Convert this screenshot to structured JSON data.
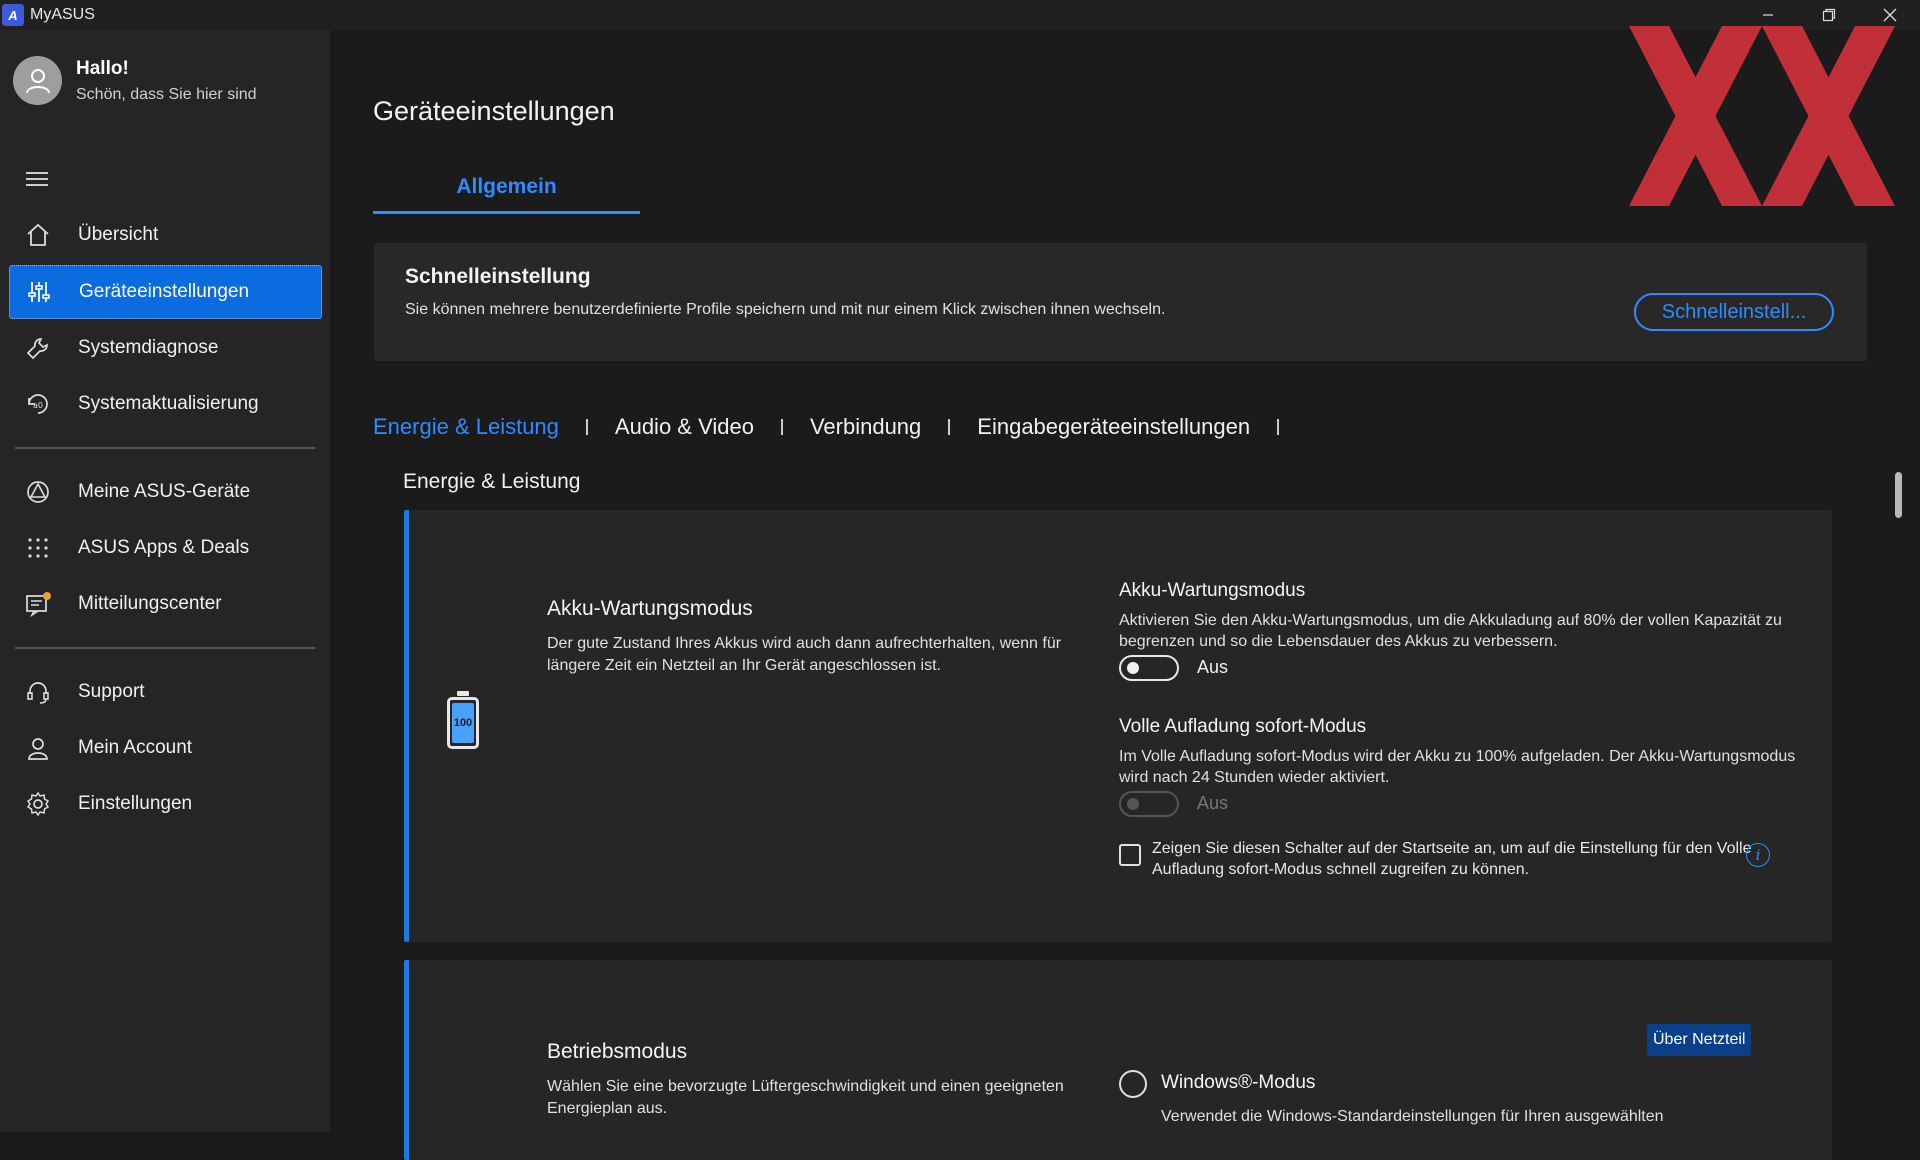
{
  "app": {
    "title": "MyASUS",
    "logo_text": "A"
  },
  "user": {
    "greeting": "Hallo!",
    "subtitle": "Schön, dass Sie hier sind"
  },
  "sidebar": {
    "items": [
      {
        "label": "Übersicht",
        "icon": "home-icon"
      },
      {
        "label": "Geräteeinstellungen",
        "icon": "sliders-icon"
      },
      {
        "label": "Systemdiagnose",
        "icon": "wrench-icon"
      },
      {
        "label": "Systemaktualisierung",
        "icon": "update-icon"
      },
      {
        "label": "Meine ASUS-Geräte",
        "icon": "devices-icon"
      },
      {
        "label": "ASUS Apps & Deals",
        "icon": "apps-grid-icon"
      },
      {
        "label": "Mitteilungscenter",
        "icon": "notification-icon"
      },
      {
        "label": "Support",
        "icon": "headset-icon"
      },
      {
        "label": "Mein Account",
        "icon": "person-icon"
      },
      {
        "label": "Einstellungen",
        "icon": "gear-icon"
      }
    ],
    "active_index": 1
  },
  "main": {
    "page_title": "Geräteeinstellungen",
    "top_tab": "Allgemein",
    "quick": {
      "title": "Schnelleinstellung",
      "description": "Sie können mehrere benutzerdefinierte Profile speichern und mit nur einem Klick zwischen ihnen wechseln.",
      "button": "Schnelleinstell..."
    },
    "subtabs": [
      "Energie & Leistung",
      "Audio & Video",
      "Verbindung",
      "Eingabegeräteeinstellungen"
    ],
    "section_title": "Energie & Leistung",
    "battery_card": {
      "title": "Akku-Wartungsmodus",
      "description": "Der gute Zustand Ihres Akkus wird auch dann aufrechterhalten, wenn für längere Zeit ein Netzteil an Ihr Gerät angeschlossen ist.",
      "battery_label": "100",
      "care_mode": {
        "title": "Akku-Wartungsmodus",
        "description": "Aktivieren Sie den Akku-Wartungsmodus, um die Akkuladung auf 80% der vollen Kapazität zu begrenzen und so die Lebensdauer des Akkus zu verbessern.",
        "state": "Aus"
      },
      "full_charge": {
        "title": "Volle Aufladung sofort-Modus",
        "description": "Im Volle Aufladung sofort-Modus wird der Akku zu 100% aufgeladen. Der Akku-Wartungsmodus wird nach 24 Stunden wieder aktiviert.",
        "state": "Aus"
      },
      "checkbox_text": "Zeigen Sie diesen Schalter auf der Startseite an, um auf die Einstellung für den Volle Aufladung sofort-Modus schnell zugreifen zu können.",
      "info_glyph": "i"
    },
    "operating_card": {
      "title": "Betriebsmodus",
      "description": "Wählen Sie eine bevorzugte Lüftergeschwindigkeit und einen geeigneten Energieplan aus.",
      "badge": "Über Netzteil",
      "radio_label": "Windows®-Modus",
      "radio_description": "Verwendet die Windows-Standardeinstellungen für Ihren ausgewählten"
    }
  },
  "colors": {
    "accent": "#2d8cff",
    "active_bg": "#0a6cdf",
    "deco": "#d0323c"
  }
}
